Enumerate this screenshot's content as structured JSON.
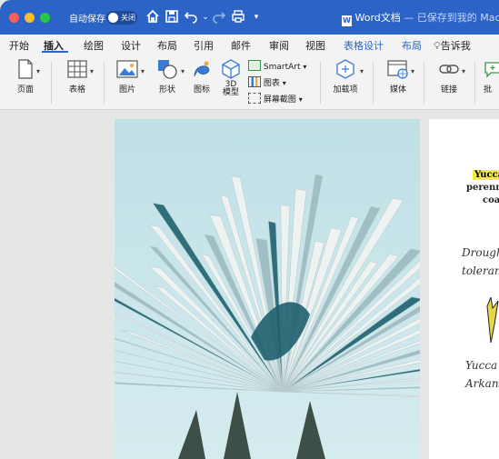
{
  "titlebar": {
    "autosave_label": "自动保存",
    "autosave_state": "关闭",
    "doc_name": "Word文档",
    "doc_status": " — 已保存到我的 Mac"
  },
  "tabs": [
    "开始",
    "插入",
    "绘图",
    "设计",
    "布局",
    "引用",
    "邮件",
    "审阅",
    "视图",
    "表格设计",
    "布局"
  ],
  "tell_me": "告诉我",
  "ribbon": {
    "page": "页面",
    "table": "表格",
    "picture": "图片",
    "shapes": "形状",
    "icons": "图标",
    "model_3d_1": "3D",
    "model_3d_2": "模型",
    "smartart": "SmartArt",
    "chart": "图表",
    "screenshot": "屏幕截图",
    "addins": "加载项",
    "media": "媒体",
    "link": "链接",
    "comment": "批"
  },
  "page2": {
    "title": "Yucca",
    "line1": "perenn",
    "line2": "coa",
    "hand1": "Drought",
    "hand2": "tolerant",
    "hand3": "Yucca",
    "hand4": "Arkansa"
  },
  "colors": {
    "titlebar": "#2b63c6",
    "ribbon": "#f3f3f3",
    "highlight": "#f7ec3b"
  }
}
